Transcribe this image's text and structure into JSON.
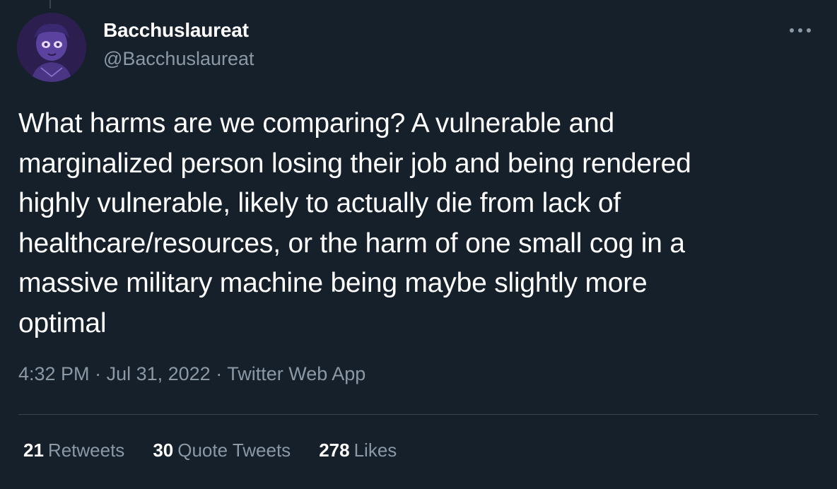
{
  "tweet": {
    "display_name": "Bacchuslaureat",
    "handle": "@Bacchuslaureat",
    "text": "What harms are we comparing? A vulnerable and\nmarginalized person losing their job and being rendered\nhighly vulnerable, likely to actually die from lack of\nhealthcare/resources, or the harm of one small cog in a\nmassive military machine being maybe slightly more\noptimal",
    "time": "4:32 PM",
    "separator": " · ",
    "date": "Jul 31, 2022",
    "source": "Twitter Web App"
  },
  "stats": [
    {
      "count": "21",
      "label": "Retweets"
    },
    {
      "count": "30",
      "label": "Quote Tweets"
    },
    {
      "count": "278",
      "label": "Likes"
    }
  ],
  "icons": {
    "more": "more-icon",
    "avatar": "avatar-image"
  },
  "colors": {
    "background": "#15202b",
    "primary_text": "#ffffff",
    "secondary_text": "#8b98a5",
    "divider": "#38444d"
  }
}
